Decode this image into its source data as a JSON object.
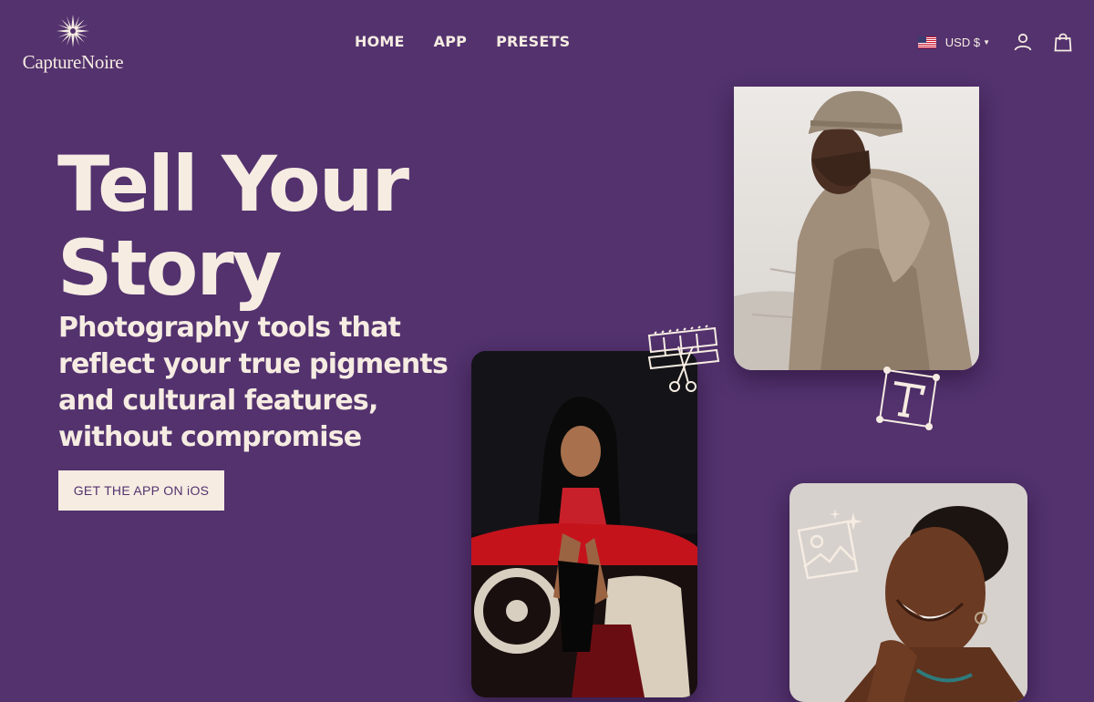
{
  "brand": {
    "name": "CaptureNoire"
  },
  "nav": {
    "items": [
      {
        "label": "HOME"
      },
      {
        "label": "APP"
      },
      {
        "label": "PRESETS"
      }
    ]
  },
  "utility": {
    "currency": "USD $",
    "flag_icon": "us-flag-icon",
    "account_icon": "user-icon",
    "cart_icon": "shopping-bag-icon"
  },
  "hero": {
    "title": "Tell Your Story",
    "subtitle": "Photography tools that reflect your true pigments and cultural features, without compromise",
    "cta_label": "GET THE APP ON iOS"
  },
  "colors": {
    "background": "#53326e",
    "text": "#f6ece2",
    "cta_bg": "#f6ece2",
    "cta_text": "#53326e"
  },
  "decorations": [
    "film-scissors-icon",
    "text-tool-icon",
    "image-sparkle-icon"
  ]
}
